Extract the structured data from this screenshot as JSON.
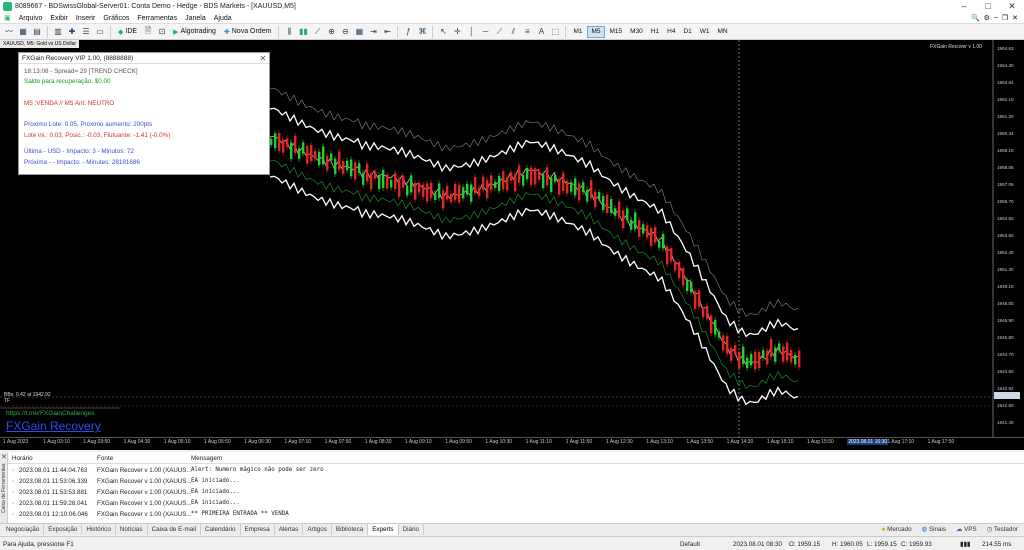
{
  "window": {
    "title": "8089667 - BDSwissGlobal-Server01: Conta Demo - Hedge - BDS Markets - [XAUUSD,M5]"
  },
  "menu": [
    "Arquivo",
    "Exibir",
    "Inserir",
    "Gráficos",
    "Ferramentas",
    "Janela",
    "Ajuda"
  ],
  "toolbar": {
    "ide": "IDE",
    "algotrading": "Algotrading",
    "new_order": "Nova Ordem",
    "timeframes": [
      "M1",
      "M5",
      "M15",
      "M30",
      "H1",
      "H4",
      "D1",
      "W1",
      "MN"
    ],
    "active_tf": "M5"
  },
  "chart": {
    "tab": "XAUUSD, M5: Gold vs US Dollar",
    "ea_label": "FXGain Recover v 1.00",
    "bid_label": "BBs: 0.42 at 1942.92",
    "tf_label": "TF",
    "telegram": "https://t.me/FXGainChallenges",
    "brand": "FXGain Recovery",
    "price_ticks": [
      "1964.63",
      "1964.30",
      "1963.64",
      "1962.10",
      "1961.20",
      "1960.34",
      "1959.10",
      "1958.06",
      "1957.06",
      "1955.70",
      "1954.60",
      "1953.50",
      "1952.40",
      "1951.30",
      "1949.10",
      "1948.00",
      "1946.90",
      "1945.80",
      "1944.70",
      "1943.60",
      "1942.92",
      "1942.50",
      "1941.40"
    ],
    "time_ticks": [
      "1 Aug 2023",
      "1 Aug 03:10",
      "1 Aug 03:50",
      "1 Aug 04:30",
      "1 Aug 05:10",
      "1 Aug 05:50",
      "1 Aug 06:30",
      "1 Aug 07:10",
      "1 Aug 07:50",
      "1 Aug 08:30",
      "1 Aug 09:10",
      "1 Aug 09:50",
      "1 Aug 10:30",
      "1 Aug 11:10",
      "1 Aug 11:50",
      "1 Aug 12:30",
      "1 Aug 13:10",
      "1 Aug 13:50",
      "1 Aug 14:30",
      "1 Aug 15:10",
      "1 Aug 15:50",
      "2023.08.01 16:30",
      "1 Aug 17:10",
      "1 Aug 17:50"
    ]
  },
  "panel": {
    "title": "FXGain Recovery VIP 1.00, (8888888)",
    "line1": "18:13:08 - Spread= 29  [TREND CHECK]",
    "line2": "Saldo para recuperação: $0.00",
    "line3": "M5 :VENDA // M5 Ant: NEUTRO",
    "line4": "Proximo Lote: 0.05, Proximo aumento: 200pts",
    "line5": "Lote ini.: 0.03, Posic.: -0.03, Flutuante: -1.41 (-0.0%)",
    "line6": "Última    - USD - Impacto: 3 - Minutos: 72",
    "line7": "Próxima   -   - Impacto:   - Minutes: 28181686"
  },
  "toolbox": {
    "side_label": "Caixa de Ferramentas",
    "columns": [
      "Horário",
      "Fonte",
      "Mensagem"
    ],
    "rows": [
      {
        "time": "2023.08.01 11:44:04.763",
        "source": "FXGain Recover v 1.00 (XAUUS...",
        "message": "Alert: Numero mágico não pode ser zero"
      },
      {
        "time": "2023.08.01 11:53:06.339",
        "source": "FXGain Recover v 1.00 (XAUUS...",
        "message": "EA iniciado..."
      },
      {
        "time": "2023.08.01 11:53:53.881",
        "source": "FXGain Recover v 1.00 (XAUUS...",
        "message": "EA iniciado..."
      },
      {
        "time": "2023.08.01 11:59:28.041",
        "source": "FXGain Recover v 1.00 (XAUUS...",
        "message": "EA iniciado..."
      },
      {
        "time": "2023.08.01 12:10:06.046",
        "source": "FXGain Recover v 1.00 (XAUUS...",
        "message": "** PRIMEIRA ENTRADA ** VENDA"
      }
    ]
  },
  "tabs": [
    "Negociação",
    "Exposição",
    "Histórico",
    "Notícias",
    "Caixa de E-mail",
    "Calendário",
    "Empresa",
    "Alertas",
    "Artigos",
    "Biblioteca",
    "Experts",
    "Diário"
  ],
  "active_tab": "Experts",
  "tabs_right": {
    "market": "Mercado",
    "signals": "Sinais",
    "vps": "VPS",
    "tester": "Testador"
  },
  "status": {
    "help": "Para Ajuda, pressione F1",
    "profile": "Default",
    "datetime": "2023.08.01 08:30",
    "open": "O: 1959.15",
    "high": "H: 1960.05",
    "low": "L: 1959.15",
    "close": "C: 1959.93",
    "speed": "214.55 ms"
  },
  "colors": {
    "bull": "#1fd030",
    "bear": "#e52525",
    "panel_green": "#1a9a1a",
    "panel_red": "#d43030",
    "panel_blue": "#3d4fd0"
  }
}
